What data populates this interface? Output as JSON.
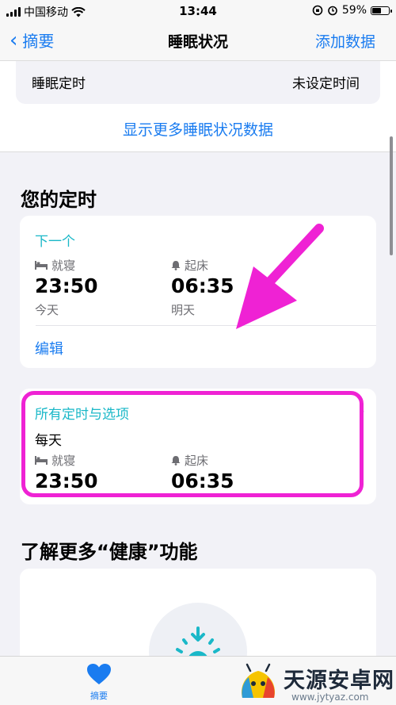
{
  "status_bar": {
    "carrier": "中国移动",
    "time": "13:44",
    "battery": "59%",
    "battery_level": 0.59
  },
  "nav": {
    "back_label": "摘要",
    "title": "睡眠状况",
    "action_label": "添加数据"
  },
  "sleep_time_row": {
    "label": "睡眠定时",
    "value": "未设定时间"
  },
  "show_more_label": "显示更多睡眠状况数据",
  "schedule_section": {
    "title": "您的定时",
    "next_card": {
      "heading": "下一个",
      "bedtime_label": "就寝",
      "bedtime_value": "23:50",
      "bedtime_day": "今天",
      "wake_label": "起床",
      "wake_value": "06:35",
      "wake_day": "明天",
      "edit_label": "编辑"
    },
    "all_card": {
      "heading": "所有定时与选项",
      "frequency": "每天",
      "bedtime_label": "就寝",
      "bedtime_value": "23:50",
      "wake_label": "起床",
      "wake_value": "06:35"
    }
  },
  "learn_section": {
    "title": "了解更多“健康”功能"
  },
  "tab_bar": {
    "summary_label": "摘要"
  },
  "watermark": {
    "text": "天源安卓网",
    "url": "www.jytyaz.com"
  },
  "colors": {
    "accent": "#1a7cf0",
    "teal": "#1ab8c8",
    "annotation_magenta": "#ef22d4"
  }
}
